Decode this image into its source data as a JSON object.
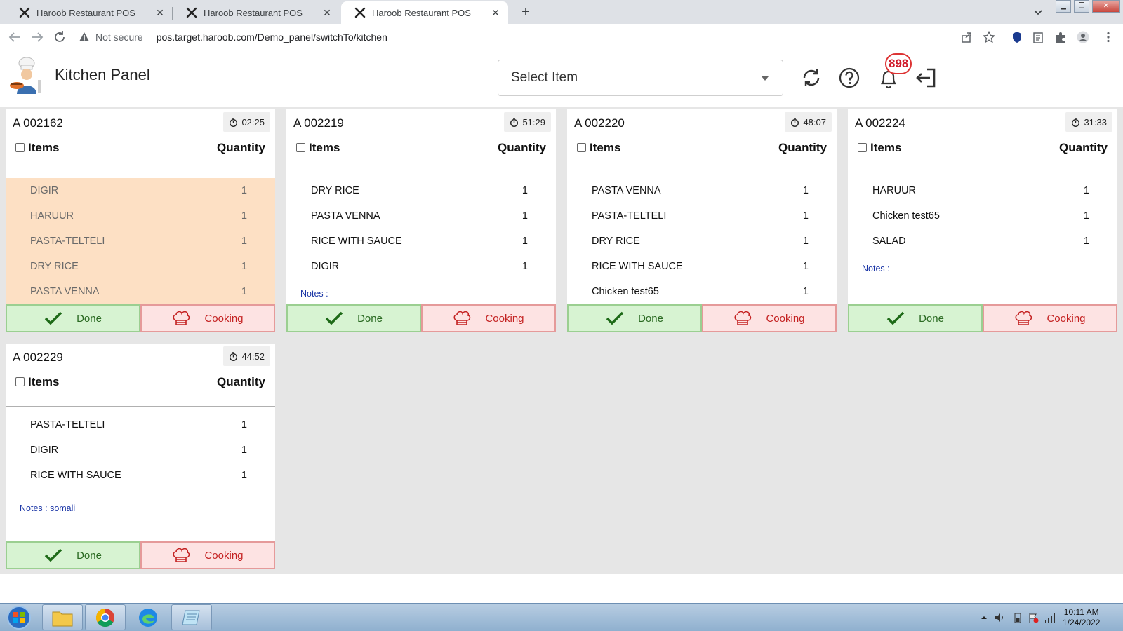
{
  "browser": {
    "tabs": [
      {
        "title": "Haroob Restaurant POS",
        "active": false
      },
      {
        "title": "Haroob Restaurant POS",
        "active": false
      },
      {
        "title": "Haroob Restaurant POS",
        "active": true
      }
    ],
    "security_label": "Not secure",
    "url": "pos.target.haroob.com/Demo_panel/switchTo/kitchen"
  },
  "header": {
    "title": "Kitchen Panel",
    "select_placeholder": "Select Item",
    "notification_count": "898"
  },
  "labels": {
    "items_header": "Items",
    "quantity_header": "Quantity",
    "done": "Done",
    "cooking": "Cooking"
  },
  "orders": [
    {
      "number": "A 002162",
      "timer": "02:25",
      "cooking": true,
      "notes": null,
      "items": [
        {
          "name": "DIGIR",
          "qty": "1"
        },
        {
          "name": "HARUUR",
          "qty": "1"
        },
        {
          "name": "PASTA-TELTELI",
          "qty": "1"
        },
        {
          "name": "DRY RICE",
          "qty": "1"
        },
        {
          "name": "PASTA VENNA",
          "qty": "1"
        }
      ]
    },
    {
      "number": "A 002219",
      "timer": "51:29",
      "cooking": false,
      "notes": "Notes :",
      "items": [
        {
          "name": "DRY RICE",
          "qty": "1"
        },
        {
          "name": "PASTA VENNA",
          "qty": "1"
        },
        {
          "name": "RICE WITH SAUCE",
          "qty": "1"
        },
        {
          "name": "DIGIR",
          "qty": "1"
        }
      ]
    },
    {
      "number": "A 002220",
      "timer": "48:07",
      "cooking": false,
      "notes": null,
      "items": [
        {
          "name": "PASTA VENNA",
          "qty": "1"
        },
        {
          "name": "PASTA-TELTELI",
          "qty": "1"
        },
        {
          "name": "DRY RICE",
          "qty": "1"
        },
        {
          "name": "RICE WITH SAUCE",
          "qty": "1"
        },
        {
          "name": "Chicken test65",
          "qty": "1"
        }
      ]
    },
    {
      "number": "A 002224",
      "timer": "31:33",
      "cooking": false,
      "notes": "Notes :",
      "items": [
        {
          "name": "HARUUR",
          "qty": "1"
        },
        {
          "name": "Chicken test65",
          "qty": "1"
        },
        {
          "name": "SALAD",
          "qty": "1"
        }
      ]
    },
    {
      "number": "A 002229",
      "timer": "44:52",
      "cooking": false,
      "notes": "Notes : somali",
      "items": [
        {
          "name": "PASTA-TELTELI",
          "qty": "1"
        },
        {
          "name": "DIGIR",
          "qty": "1"
        },
        {
          "name": "RICE WITH SAUCE",
          "qty": "1"
        }
      ]
    }
  ],
  "taskbar": {
    "time": "10:11 AM",
    "date": "1/24/2022"
  },
  "colors": {
    "cooking_highlight": "#fde0c4",
    "done_bg": "#d7f3d2",
    "cooking_btn_bg": "#fde3e3",
    "notes_text": "#1a35a6",
    "badge_red": "#d01a2a"
  }
}
